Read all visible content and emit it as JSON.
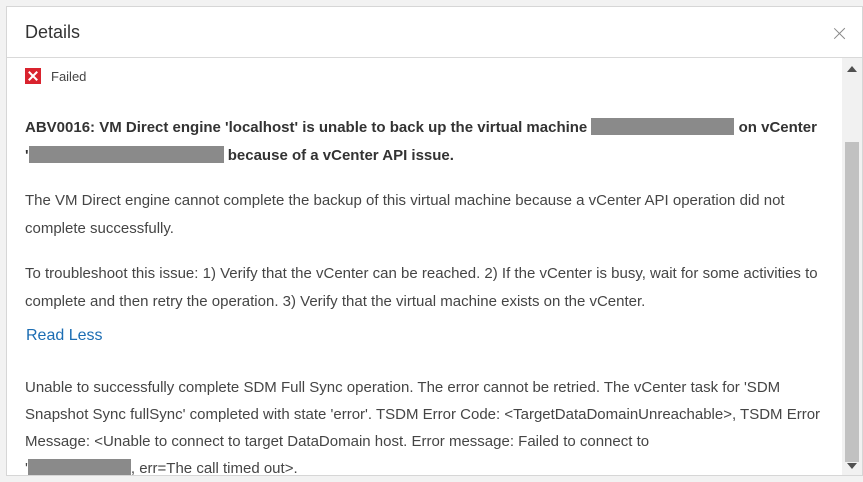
{
  "dialog": {
    "title": "Details",
    "close_icon": "close-icon"
  },
  "status": {
    "icon": "fail-icon",
    "label": "Failed",
    "color": "#d9232e"
  },
  "error": {
    "line1_prefix": "ABV0016: VM Direct engine 'localhost' is unable to back up the virtual machine",
    "line1_suffix": " on vCenter",
    "line2_prefix": "'",
    "line2_suffix": " because of a vCenter API issue."
  },
  "description": "The VM Direct engine cannot complete the backup of this virtual machine because a vCenter API operation did not complete successfully.",
  "troubleshoot": "To troubleshoot this issue: 1) Verify that the vCenter can be reached. 2) If the vCenter is busy, wait for some activities to complete and then retry the operation. 3) Verify that the virtual machine exists on the vCenter.",
  "read_less": "Read Less",
  "details": {
    "text": "Unable to successfully complete SDM Full Sync operation. The error cannot be retried. The vCenter task for 'SDM Snapshot Sync fullSync' completed with state 'error'. TSDM Error Code: <TargetDataDomainUnreachable>, TSDM Error Message: <Unable to connect to target DataDomain host. Error message: Failed to connect to",
    "last_prefix": "'",
    "last_suffix": ", err=The call timed out>."
  },
  "colors": {
    "link": "#1c6db3",
    "redaction": "#8a8a8a"
  }
}
